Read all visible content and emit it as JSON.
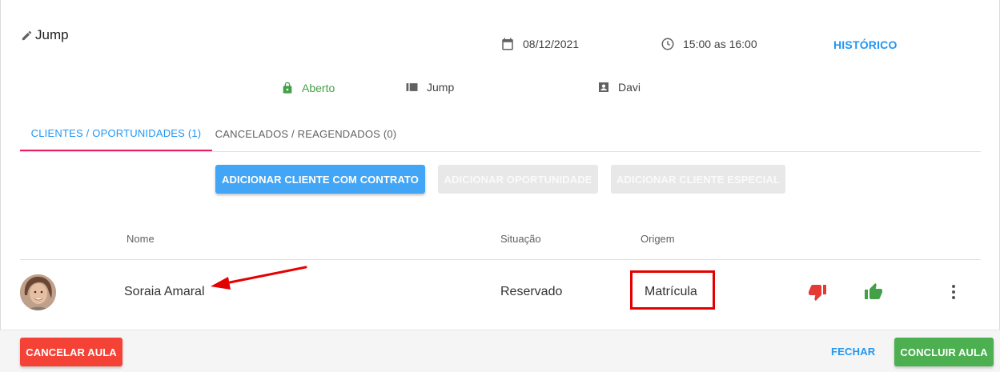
{
  "header": {
    "title": "Jump",
    "date": "08/12/2021",
    "time": "15:00 as 16:00",
    "history_link": "HISTÓRICO",
    "status": "Aberto",
    "modality": "Jump",
    "instructor": "Davi"
  },
  "tabs": [
    {
      "label": "CLIENTES / OPORTUNIDADES (1)",
      "active": true
    },
    {
      "label": "CANCELADOS / REAGENDADOS (0)",
      "active": false
    }
  ],
  "actions": {
    "add_contract_client": "ADICIONAR CLIENTE COM CONTRATO",
    "add_opportunity": "ADICIONAR OPORTUNIDADE",
    "add_special_client": "ADICIONAR CLIENTE ESPECIAL"
  },
  "table": {
    "columns": [
      "Nome",
      "Situação",
      "Origem"
    ],
    "rows": [
      {
        "name": "Soraia Amaral",
        "situation": "Reservado",
        "origin": "Matrícula"
      }
    ]
  },
  "footer": {
    "cancel_class": "CANCELAR AULA",
    "close": "FECHAR",
    "conclude_class": "CONCLUIR AULA"
  },
  "icons": {
    "title": "pencil-icon",
    "date": "calendar-icon",
    "time": "clock-icon",
    "status": "lock-icon",
    "modality": "list-icon",
    "instructor": "badge-icon",
    "dislike": "thumb-down-icon",
    "like": "thumb-up-icon",
    "menu": "more-vert-icon"
  },
  "colors": {
    "accent_blue": "#2196f3",
    "primary_button": "#42a5f5",
    "tab_indicator": "#e91e63",
    "status_green": "#43a047",
    "danger": "#f44336",
    "success": "#4caf50",
    "annotation_red": "#e50000"
  }
}
